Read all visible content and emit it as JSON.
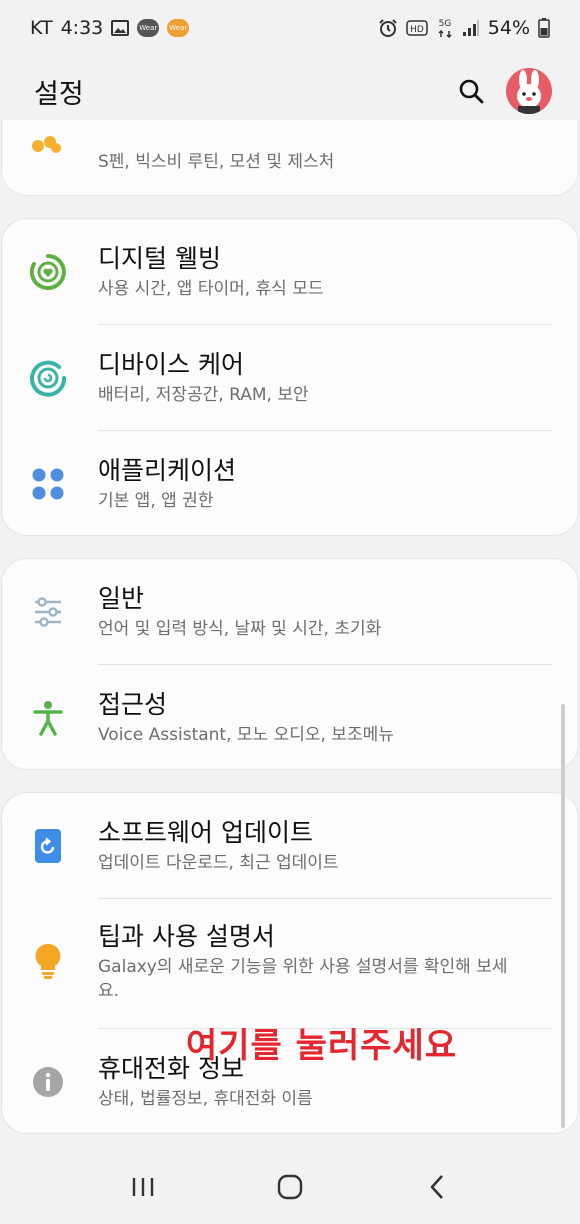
{
  "status_bar": {
    "carrier": "KT",
    "time": "4:33",
    "wear_badge_1": "Wear",
    "wear_badge_2": "Wear",
    "network": "5G",
    "hd": "HD",
    "battery": "54%"
  },
  "header": {
    "title": "설정"
  },
  "top_card": {
    "subtitle": "S펜, 빅스비 루틴, 모션 및 제스처"
  },
  "cards": [
    {
      "items": [
        {
          "title": "디지털 웰빙",
          "subtitle": "사용 시간, 앱 타이머, 휴식 모드",
          "icon": "digital-wellbeing-icon",
          "color": "#5fb043"
        },
        {
          "title": "디바이스 케어",
          "subtitle": "배터리, 저장공간, RAM, 보안",
          "icon": "device-care-icon",
          "color": "#39b5a6"
        },
        {
          "title": "애플리케이션",
          "subtitle": "기본 앱, 앱 권한",
          "icon": "apps-icon",
          "color": "#4e8fe0"
        }
      ]
    },
    {
      "items": [
        {
          "title": "일반",
          "subtitle": "언어 및 입력 방식, 날짜 및 시간, 초기화",
          "icon": "general-sliders-icon",
          "color": "#9cb6c8"
        },
        {
          "title": "접근성",
          "subtitle": "Voice Assistant, 모노 오디오, 보조메뉴",
          "icon": "accessibility-icon",
          "color": "#56b24b"
        }
      ]
    },
    {
      "items": [
        {
          "title": "소프트웨어 업데이트",
          "subtitle": "업데이트 다운로드, 최근 업데이트",
          "icon": "software-update-icon",
          "color": "#3e8ee8"
        },
        {
          "title": "팁과 사용 설명서",
          "subtitle": "Galaxy의 새로운 기능을 위한 사용 설명서를 확인해 보세요.",
          "icon": "lightbulb-icon",
          "color": "#f5a623"
        },
        {
          "title": "휴대전화 정보",
          "subtitle": "상태, 법률정보, 휴대전화 이름",
          "icon": "info-icon",
          "color": "#9b9b9b"
        }
      ]
    }
  ],
  "overlay": {
    "text": "여기를 눌러주세요",
    "color": "#e5262e"
  }
}
